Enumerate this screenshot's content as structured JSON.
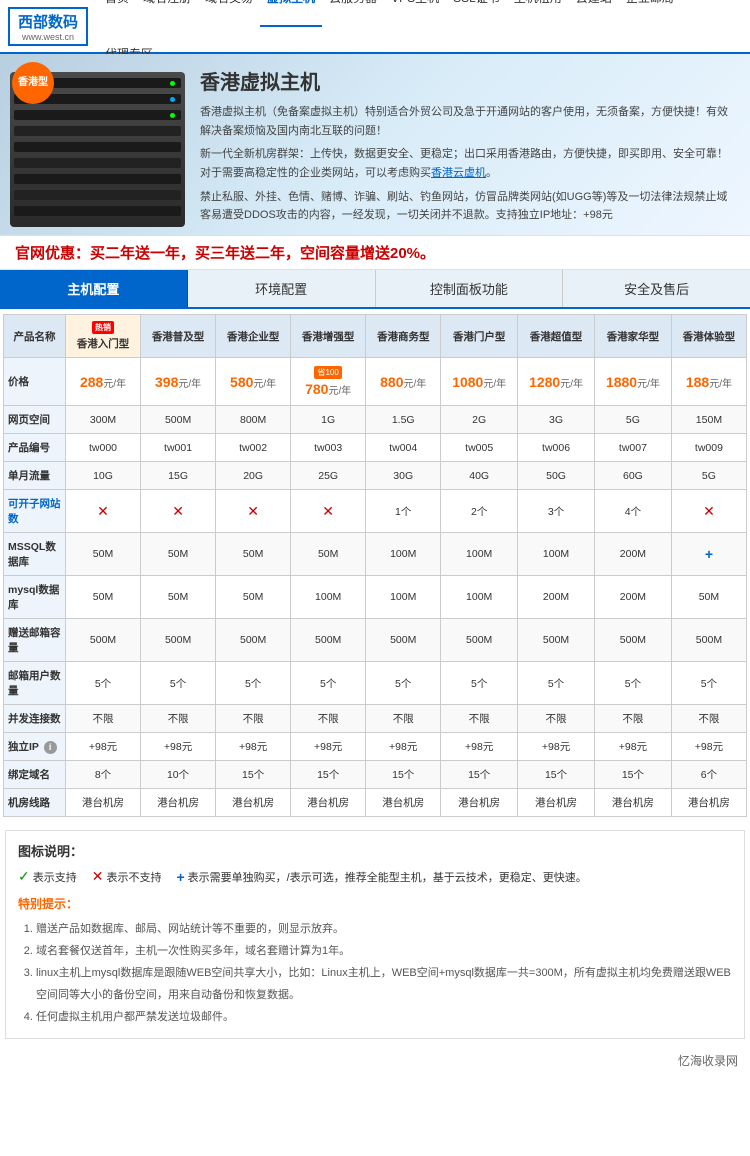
{
  "site": {
    "logo_title": "西部数码",
    "logo_sub": "www.west.cn"
  },
  "nav": {
    "items": [
      {
        "label": "首页",
        "active": false
      },
      {
        "label": "域名注册",
        "active": false
      },
      {
        "label": "域名交易",
        "active": false
      },
      {
        "label": "虚拟主机",
        "active": true
      },
      {
        "label": "云服务器",
        "active": false
      },
      {
        "label": "VPS主机",
        "active": false
      },
      {
        "label": "SSL证书",
        "active": false
      },
      {
        "label": "主机租用",
        "active": false
      },
      {
        "label": "云建站",
        "active": false
      },
      {
        "label": "企业邮局",
        "active": false
      },
      {
        "label": "代理专区",
        "active": false
      }
    ]
  },
  "hero": {
    "badge": "香港型",
    "title": "香港虚拟主机",
    "desc1": "香港虚拟主机（免备案虚拟主机）特别适合外贸公司及急于开通网站的客户使用，无须备案，方便快捷！有效解决备案烦恼及国内南北互联的问题！",
    "desc2": "新一代全新机房群架：上传快，数据更安全、更稳定；出口采用香港路由，方便快捷，即买即用、安全可靠！对于需要高稳定性的企业类网站，可以考虑购买",
    "link_text": "香港云虚机",
    "desc3": "。",
    "desc4": "禁止私服、外挂、色情、赌博、诈骗、刷站、钓鱼网站，仿冒品牌类网站(如UGG等)等及一切法律法规禁止域客易遭受DDOS攻击的内容，一经发现，一切关闭并不退款。支持独立IP地址：+98元"
  },
  "promo": {
    "text": "官网优惠：买二年送一年，买三年送二年，空间容量增送20%。"
  },
  "tabs": [
    {
      "label": "主机配置",
      "active": true
    },
    {
      "label": "环境配置",
      "active": false
    },
    {
      "label": "控制面板功能",
      "active": false
    },
    {
      "label": "安全及售后",
      "active": false
    }
  ],
  "table": {
    "headers": [
      "产品名称",
      "香港入门型",
      "香港普及型",
      "香港企业型",
      "香港增强型",
      "香港商务型",
      "香港门户型",
      "香港超值型",
      "香港家华型",
      "香港体验型"
    ],
    "hot_col": "香港入门型",
    "rows": [
      {
        "label": "价格",
        "values": [
          {
            "price": "288",
            "unit": "元/年",
            "tag": null
          },
          {
            "price": "398",
            "unit": "元/年",
            "tag": null
          },
          {
            "price": "580",
            "unit": "元/年",
            "tag": null
          },
          {
            "price": "780",
            "unit": "元/年",
            "tag": "省100"
          },
          {
            "price": "880",
            "unit": "元/年",
            "tag": null
          },
          {
            "price": "1080",
            "unit": "元/年",
            "tag": null
          },
          {
            "price": "1280",
            "unit": "元/年",
            "tag": null
          },
          {
            "price": "1880",
            "unit": "元/年",
            "tag": null
          },
          {
            "price": "188",
            "unit": "元/年",
            "tag": null
          }
        ]
      },
      {
        "label": "网页空间",
        "values": [
          "300M",
          "500M",
          "800M",
          "1G",
          "1.5G",
          "2G",
          "3G",
          "5G",
          "150M"
        ]
      },
      {
        "label": "产品编号",
        "values": [
          "tw000",
          "tw001",
          "tw002",
          "tw003",
          "tw004",
          "tw005",
          "tw006",
          "tw007",
          "tw009"
        ]
      },
      {
        "label": "单月流量",
        "values": [
          "10G",
          "15G",
          "20G",
          "25G",
          "30G",
          "40G",
          "50G",
          "60G",
          "5G"
        ]
      },
      {
        "label": "可开子网站数",
        "values": [
          "×",
          "×",
          "×",
          "×",
          "1个",
          "2个",
          "3个",
          "4个",
          "×"
        ],
        "link": true
      },
      {
        "label": "MSSQL数据库",
        "values": [
          "50M",
          "50M",
          "50M",
          "50M",
          "100M",
          "100M",
          "100M",
          "200M",
          "+"
        ]
      },
      {
        "label": "mysql数据库",
        "values": [
          "50M",
          "50M",
          "50M",
          "100M",
          "100M",
          "100M",
          "200M",
          "200M",
          "50M"
        ]
      },
      {
        "label": "赠送邮箱容量",
        "values": [
          "500M",
          "500M",
          "500M",
          "500M",
          "500M",
          "500M",
          "500M",
          "500M",
          "500M"
        ]
      },
      {
        "label": "邮箱用户数量",
        "values": [
          "5个",
          "5个",
          "5个",
          "5个",
          "5个",
          "5个",
          "5个",
          "5个",
          "5个"
        ]
      },
      {
        "label": "并发连接数",
        "values": [
          "不限",
          "不限",
          "不限",
          "不限",
          "不限",
          "不限",
          "不限",
          "不限",
          "不限"
        ]
      },
      {
        "label": "独立IP",
        "values": [
          "+98元",
          "+98元",
          "+98元",
          "+98元",
          "+98元",
          "+98元",
          "+98元",
          "+98元",
          "+98元"
        ],
        "has_info": true
      },
      {
        "label": "绑定域名",
        "values": [
          "8个",
          "10个",
          "15个",
          "15个",
          "15个",
          "15个",
          "15个",
          "15个",
          "6个"
        ]
      },
      {
        "label": "机房线路",
        "values": [
          "港台机房",
          "港台机房",
          "港台机房",
          "港台机房",
          "港台机房",
          "港台机房",
          "港台机房",
          "港台机房",
          "港台机房"
        ]
      }
    ]
  },
  "legend": {
    "title": "图标说明：",
    "items": [
      {
        "symbol": "✓",
        "type": "check",
        "desc": "表示支持"
      },
      {
        "symbol": "×",
        "type": "cross",
        "desc": "表示不支持"
      },
      {
        "symbol": "+",
        "type": "plus",
        "desc": "表示需要单独购买，/表示可选，推荐全能型主机，基于云技术，更稳定、更快速。"
      }
    ]
  },
  "notices": {
    "title": "特别提示：",
    "items": [
      "赠送产品如数据库、邮局、网站统计等不重要的，则显示放弃。",
      "域名套餐仅送首年，主机一次性购买多年，域名套赠计算为1年。",
      "linux主机上mysql数据库是跟随WEB空间共享大小，比如：Linux主机上，WEB空间+mysql数据库一共=300M，所有虚拟主机均免费赠送跟WEB空间同等大小的备份空间，用来自动备份和恢复数据。",
      "任何虚拟主机用户都严禁发送垃圾邮件。"
    ]
  },
  "footer": {
    "text": "忆海收录网"
  }
}
